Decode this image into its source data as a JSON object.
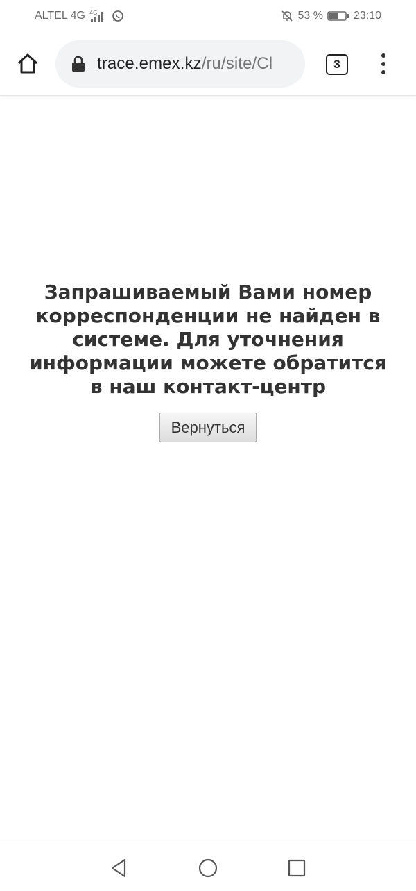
{
  "status_bar": {
    "carrier": "ALTEL 4G",
    "battery": "53 %",
    "time": "23:10",
    "icons": [
      "signal-4g-icon",
      "whatsapp-icon",
      "mute-notifications-icon",
      "battery-icon"
    ]
  },
  "browser": {
    "url_domain": "trace.emex.kz",
    "url_path": "/ru/site/Cl",
    "tabs_count": "3",
    "icons": [
      "home-icon",
      "lock-icon",
      "more-menu-icon"
    ]
  },
  "page": {
    "message": "Запрашиваемый Вами номер корреспонденции не найден в системе. Для уточнения информации можете обратится в наш контакт-центр",
    "back_button": "Вернуться"
  },
  "nav": {
    "icons": [
      "back-triangle-icon",
      "home-circle-icon",
      "recents-square-icon"
    ]
  },
  "colors": {
    "url_bar_bg": "#f1f3f4",
    "text": "#333333",
    "status_text": "#6b6b6b"
  }
}
